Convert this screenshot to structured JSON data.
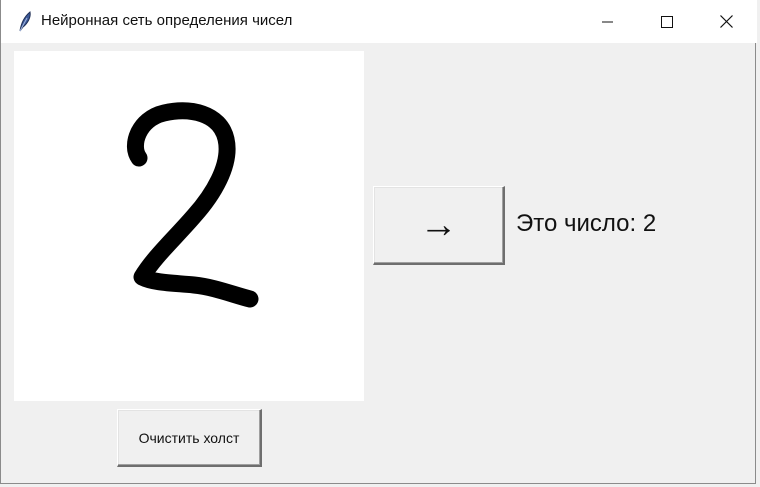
{
  "window": {
    "title": "Нейронная сеть определения чисел",
    "icon": "feather-icon",
    "controls": {
      "minimize": "minimize-icon",
      "maximize": "maximize-icon",
      "close": "close-icon"
    }
  },
  "canvas": {
    "background": "#ffffff",
    "stroke_color": "#000000",
    "drawn_digit": "2"
  },
  "predict_button": {
    "label": "→"
  },
  "result": {
    "text": "Это число: 2"
  },
  "clear_button": {
    "label": "Очистить холст"
  }
}
